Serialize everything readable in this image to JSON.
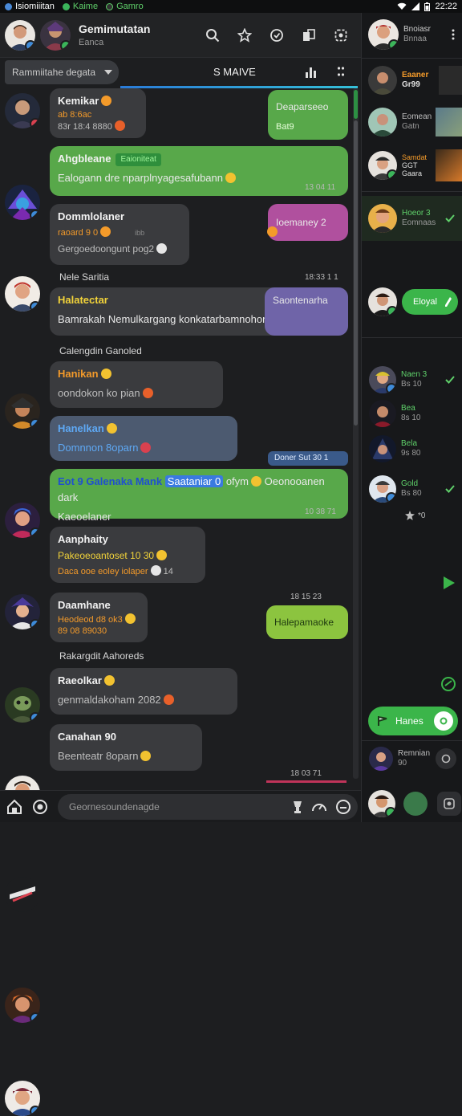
{
  "statusbar": {
    "apps": [
      "Isiomiiitan",
      "Kaime",
      "Gamro"
    ],
    "time": "22:22"
  },
  "header": {
    "title": "Gemimutatan",
    "subtitle": "Eanca"
  },
  "subbar": {
    "dropdown": "Rammiitahe degata",
    "title": "S MAIVE"
  },
  "messages": [
    {
      "name": "Kemikar",
      "line1": "ab 8:6ac",
      "line2": "83r 18:4 8880",
      "reply": "Deaparseeo",
      "reply2": "Bat9"
    },
    {
      "name": "Ahgbleane",
      "tag": "Eaioniteat",
      "text": "Ealogann dre nparplnyagesafubann",
      "time": "13 04 11"
    },
    {
      "name": "Dommlolaner",
      "line1": "raoard 9 0",
      "line1b": "ibb",
      "text": "Gergoedoongunt pog2",
      "reply": "Ioemaney 2"
    },
    {
      "system": "Nele Saritia",
      "time": "18:33 1 1"
    },
    {
      "name": "Halatectar",
      "text": "Bamrakah Nemulkargang konkatarbamnohon",
      "reply": "Saontenarha"
    },
    {
      "system": "Calengdin Ganoled"
    },
    {
      "name": "Hanikan",
      "text": "oondokon ko pian"
    },
    {
      "name": "Hanelkan",
      "text": "Domnnon 8oparn",
      "status": "Doner Sut 30 1"
    },
    {
      "text": "Eot 9 Galenaka Mank",
      "highlight": "Saataniar 0",
      "text2": "ofym",
      "text3": "Oeonooanen dark",
      "text4": "Kaeoelaner",
      "time": "10 38 71"
    },
    {
      "name": "Aanphaity",
      "line1": "Pakeoeoantoset 10 30",
      "line2": "Daca ooe eoley iolaper",
      "line2b": "14"
    },
    {
      "name": "Daamhane",
      "line1": "Heodeod d8 ok3",
      "line2": "89 08 89030",
      "time": "18 15 23",
      "reply": "Halepamaoke"
    },
    {
      "system": "Rakargdit Aahoreds"
    },
    {
      "name": "Raeolkar",
      "text": "genmaldakoham 2082"
    },
    {
      "name": "Canahan 90",
      "text": "Beenteatr 8oparn",
      "time": "18 03 71"
    }
  ],
  "input": {
    "placeholder": "Geornesoundenagde"
  },
  "right_panel": {
    "top": {
      "name": "Bnoiasr",
      "sub": "Bnnaa"
    },
    "items": [
      {
        "l1": "Eaaner",
        "l2": "Gr99"
      },
      {
        "l1": "Eomean",
        "l2": "Gatn"
      },
      {
        "l1": "Samdat",
        "l2": "GGT",
        "l3": "Gaara"
      },
      {
        "l1": "Hoeor 3",
        "l2": "Eomnaas"
      },
      {
        "label": "Eloyal"
      },
      {
        "l1": "Naen 3",
        "l2": "Bs 10"
      },
      {
        "l1": "Bea",
        "l2": "8s 10"
      },
      {
        "l1": "Bela",
        "l2": "9s 80"
      },
      {
        "l1": "Gold",
        "l2": "Bs 80"
      },
      {
        "l1": "",
        "l2": "*0"
      }
    ],
    "action_button": "Hanes",
    "bottom": {
      "l1": "Remnian",
      "l2": "90"
    }
  },
  "colors": {
    "accent_green": "#58a84a",
    "accent_blue": "#2a7bd8",
    "bg": "#1d1e20"
  }
}
